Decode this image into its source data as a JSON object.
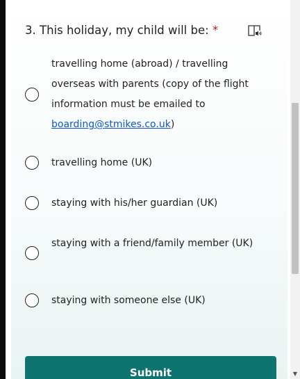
{
  "question": {
    "title": "3. This holiday, my child will be:",
    "required_marker": "*",
    "reader_icon": "immersive-reader-icon"
  },
  "options": [
    {
      "label_prefix": "travelling home (abroad) / travelling overseas with parents (copy of the flight information must be emailed to ",
      "link_text": "boarding@stmikes.co.uk",
      "label_suffix": ")"
    },
    {
      "label": "travelling home (UK)"
    },
    {
      "label": "staying with his/her guardian (UK)"
    },
    {
      "label": "staying with a friend/family member (UK)"
    },
    {
      "label": "staying with someone else (UK)"
    }
  ],
  "submit": {
    "label": "Submit"
  },
  "colors": {
    "accent": "#0f7470",
    "required": "#a4262c",
    "link": "#0b57d0"
  }
}
